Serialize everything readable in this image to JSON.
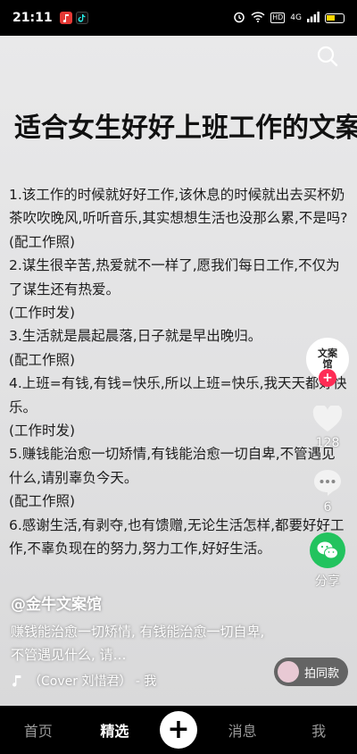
{
  "status_bar": {
    "time": "21:11",
    "network_label": "HD",
    "signal_label": "4G"
  },
  "paper": {
    "title": "适合女生好好上班工作的文案",
    "lines": [
      "1.该工作的时候就好好工作,该休息的时候就出去买杯奶茶吹吹晚风,听听音乐,其实想想生活也没那么累,不是吗?",
      "(配工作照)",
      "2.谋生很辛苦,热爱就不一样了,愿我们每日工作,不仅为了谋生还有热爱。",
      "(工作时发)",
      "3.生活就是晨起晨落,日子就是早出晚归。",
      "(配工作照)",
      "4.上班=有钱,有钱=快乐,所以上班=快乐,我天天都好快乐。",
      "(工作时发)",
      "5.赚钱能治愈一切矫情,有钱能治愈一切自卑,不管遇见什么,请别辜负今天。",
      "(配工作照)",
      "6.感谢生活,有剥夺,也有馈赠,无论生活怎样,都要好好工作,不辜负现在的努力,努力工作,好好生活。"
    ]
  },
  "overlay": {
    "author": "@金牛文案馆",
    "description": "赚钱能治愈一切矫情, 有钱能治愈一切自卑, 不管遇见什么, 请…",
    "music": "（Cover 刘惜君） - 我",
    "avatar_text": "文案馆",
    "like_count": "128",
    "comment_count": "6",
    "share_label": "分享",
    "pai_label": "拍同款"
  },
  "nav": {
    "home": "首页",
    "featured": "精选",
    "add": "+",
    "messages": "消息",
    "me": "我"
  },
  "colors": {
    "accent": "#fe2c55",
    "share": "#22c35e"
  }
}
